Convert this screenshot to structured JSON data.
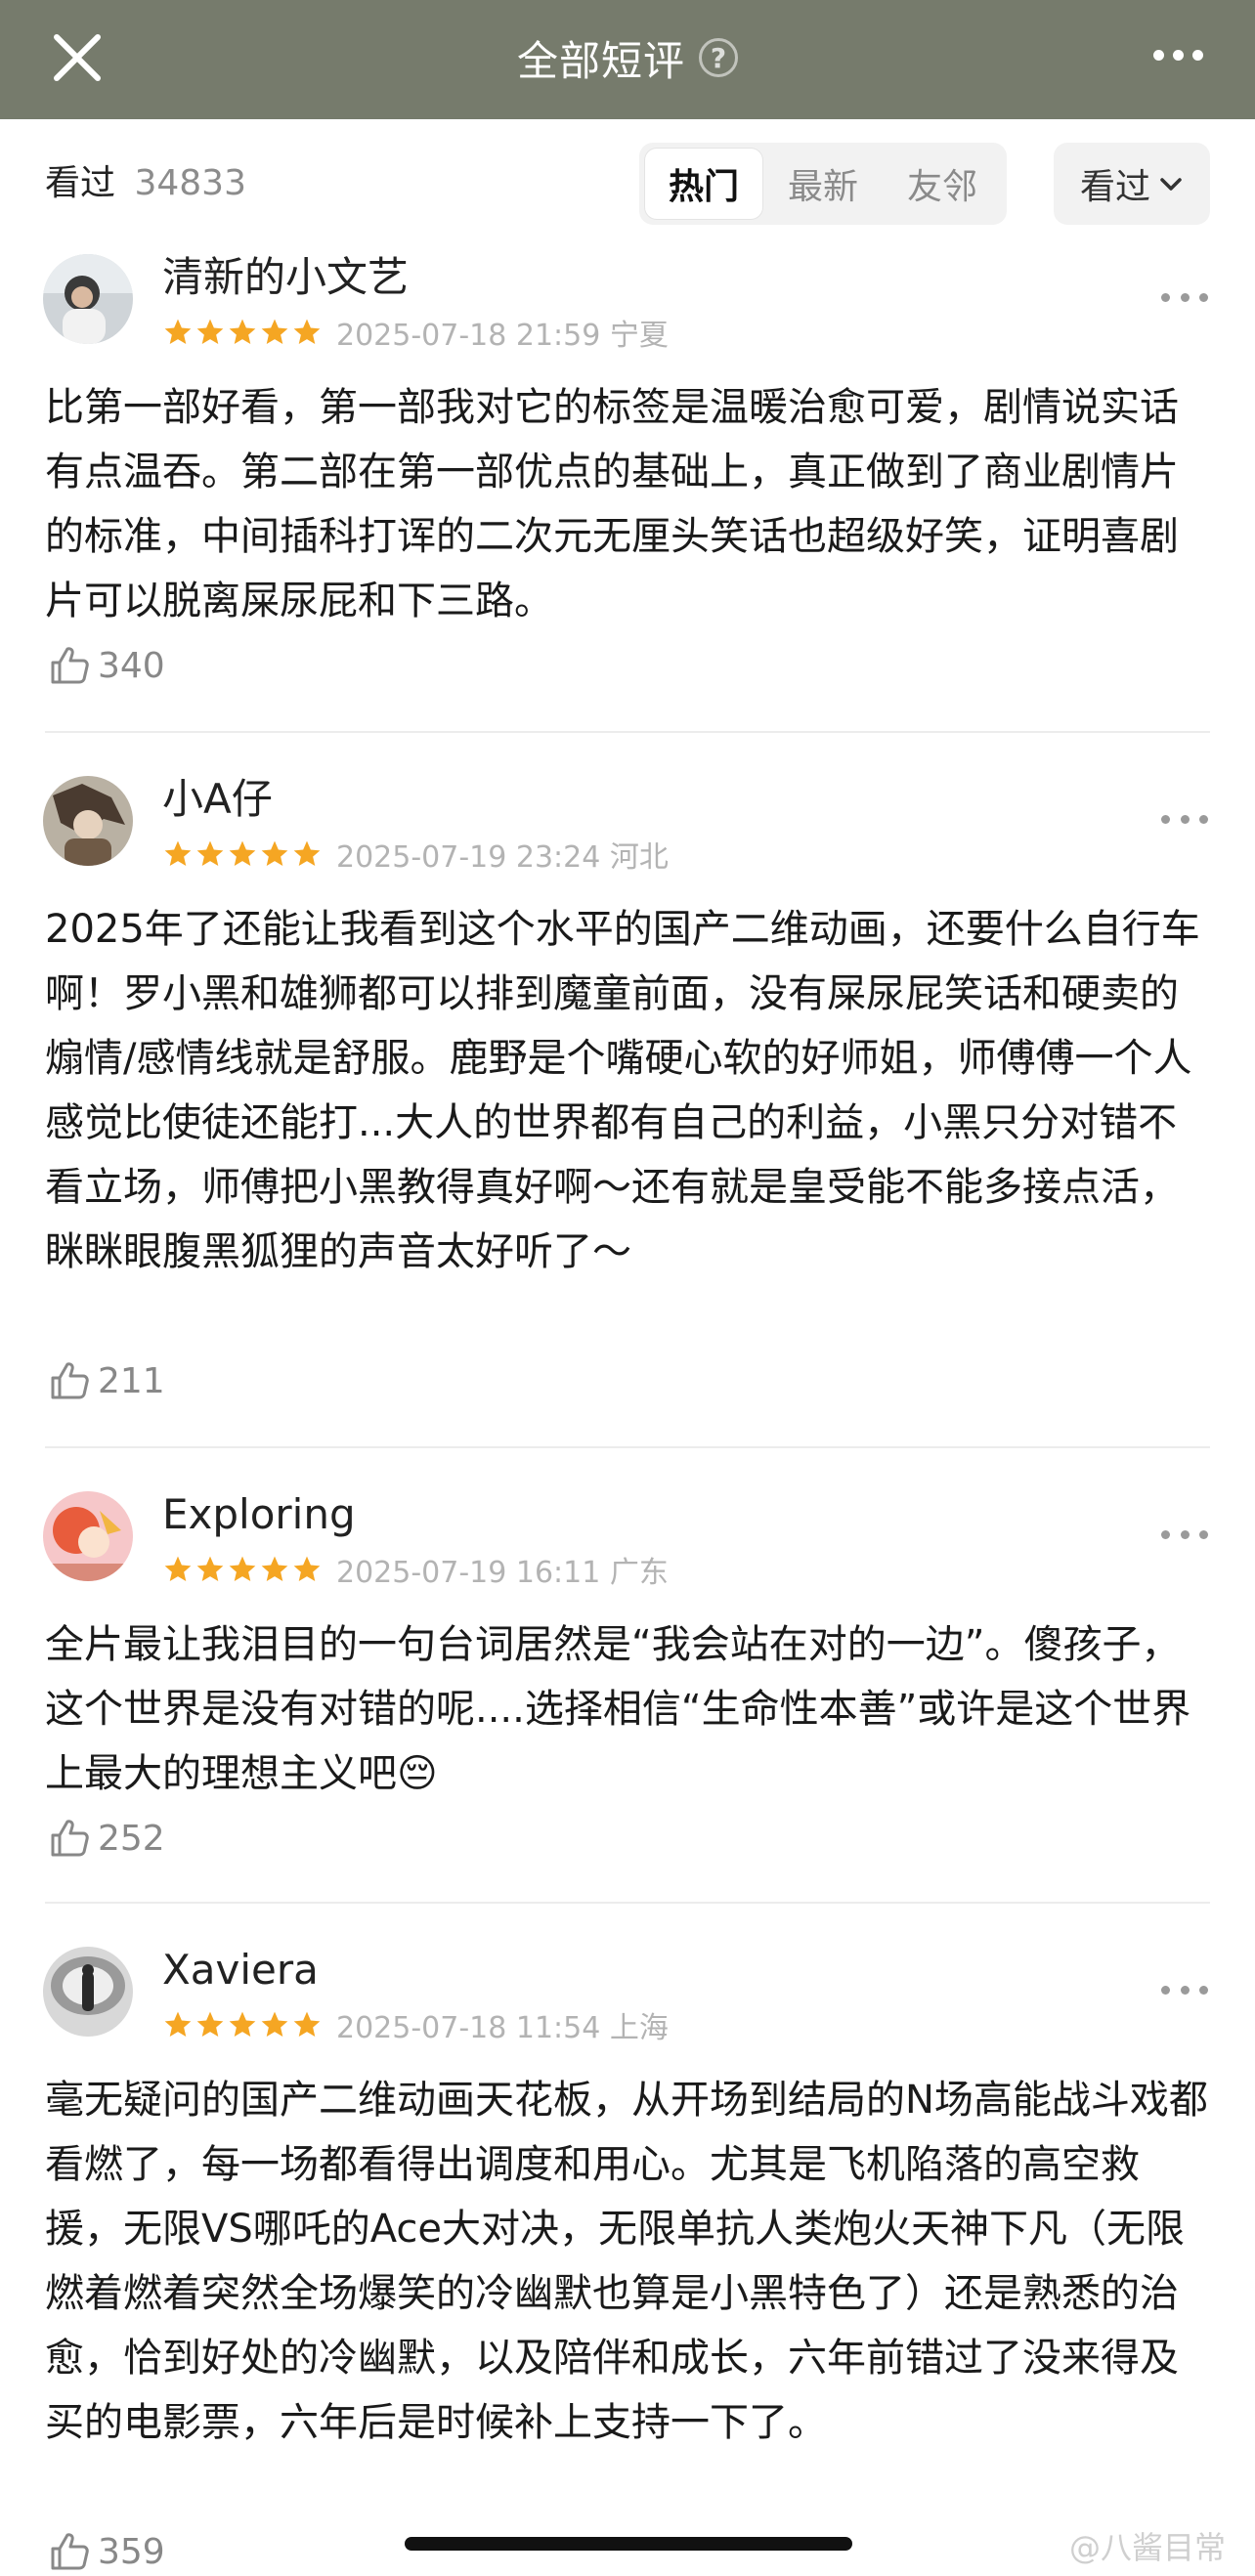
{
  "header": {
    "title": "全部短评",
    "help_glyph": "?"
  },
  "filter": {
    "seen_label": "看过",
    "seen_count": "34833",
    "tabs": [
      "热门",
      "最新",
      "友邻"
    ],
    "active_tab": "热门",
    "dropdown_label": "看过"
  },
  "colors": {
    "header_bg": "#767b6c",
    "star": "#f5a623"
  },
  "comments": [
    {
      "username": "清新的小文艺",
      "rating": 5,
      "date": "2025-07-18 21:59 宁夏",
      "text": "比第一部好看，第一部我对它的标签是温暖治愈可爱，剧情说实话有点温吞。第二部在第一部优点的基础上，真正做到了商业剧情片的标准，中间插科打诨的二次元无厘头笑话也超级好笑，证明喜剧片可以脱离屎尿屁和下三路。",
      "likes": "340"
    },
    {
      "username": "小A仔",
      "rating": 5,
      "date": "2025-07-19 23:24 河北",
      "text": "2025年了还能让我看到这个水平的国产二维动画，还要什么自行车啊！罗小黑和雄狮都可以排到魔童前面，没有屎尿屁笑话和硬卖的煽情/感情线就是舒服。鹿野是个嘴硬心软的好师姐，师傅傅一个人感觉比使徒还能打...大人的世界都有自己的利益，小黑只分对错不看立场，师傅把小黑教得真好啊～还有就是皇受能不能多接点活，眯眯眼腹黑狐狸的声音太好听了～",
      "likes": "211"
    },
    {
      "username": "Exploring",
      "rating": 5,
      "date": "2025-07-19 16:11 广东",
      "text": "全片最让我泪目的一句台词居然是“我会站在对的一边”。傻孩子，这个世界是没有对错的呢....选择相信“生命性本善”或许是这个世界上最大的理想主义吧😔",
      "likes": "252"
    },
    {
      "username": "Xaviera",
      "rating": 5,
      "date": "2025-07-18 11:54 上海",
      "text": "毫无疑问的国产二维动画天花板，从开场到结局的N场高能战斗戏都看燃了，每一场都看得出调度和用心。尤其是飞机陷落的高空救援，无限VS哪吒的Ace大对决，无限单抗人类炮火天神下凡（无限燃着燃着突然全场爆笑的冷幽默也算是小黑特色了）还是熟悉的治愈，恰到好处的冷幽默，以及陪伴和成长，六年前错过了没来得及买的电影票，六年后是时候补上支持一下了。",
      "likes": "359"
    }
  ],
  "watermark": "@八酱目常"
}
